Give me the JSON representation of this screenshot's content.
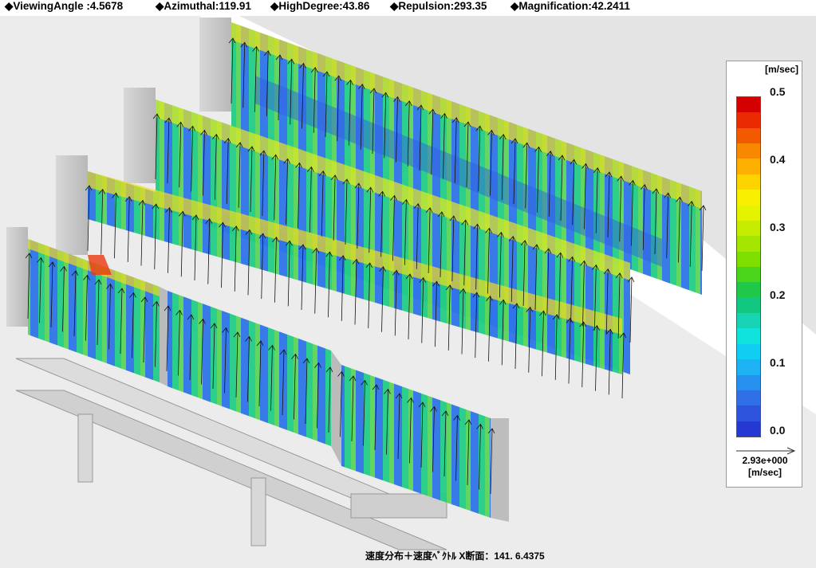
{
  "header": {
    "viewing_angle": "◆ViewingAngle :4.5678",
    "azimuthal": "◆Azimuthal:119.91",
    "high_degree": "◆HighDegree:43.86",
    "repulsion": "◆Repulsion:293.35",
    "magnification": "◆Magnification:42.2411"
  },
  "legend": {
    "unit": "[m/sec]",
    "ticks": [
      "0.5",
      "0.4",
      "0.3",
      "0.2",
      "0.1",
      "0.0"
    ],
    "ref_value": "2.93e+000",
    "ref_unit": "[m/sec]",
    "colors": [
      "#d40000",
      "#ea2a00",
      "#f25a00",
      "#f88800",
      "#fdb000",
      "#fed400",
      "#f8f000",
      "#e4f400",
      "#c6ec00",
      "#a4e600",
      "#7ede00",
      "#4ad41a",
      "#20c84a",
      "#12c880",
      "#16d4b4",
      "#10e2dc",
      "#10cef2",
      "#1cb2f4",
      "#2690ee",
      "#2f70e6",
      "#2e54de",
      "#2638d2"
    ]
  },
  "caption": "速度分布＋速度ﾍﾞｸﾄﾙ X断面：141. 6.4375"
}
